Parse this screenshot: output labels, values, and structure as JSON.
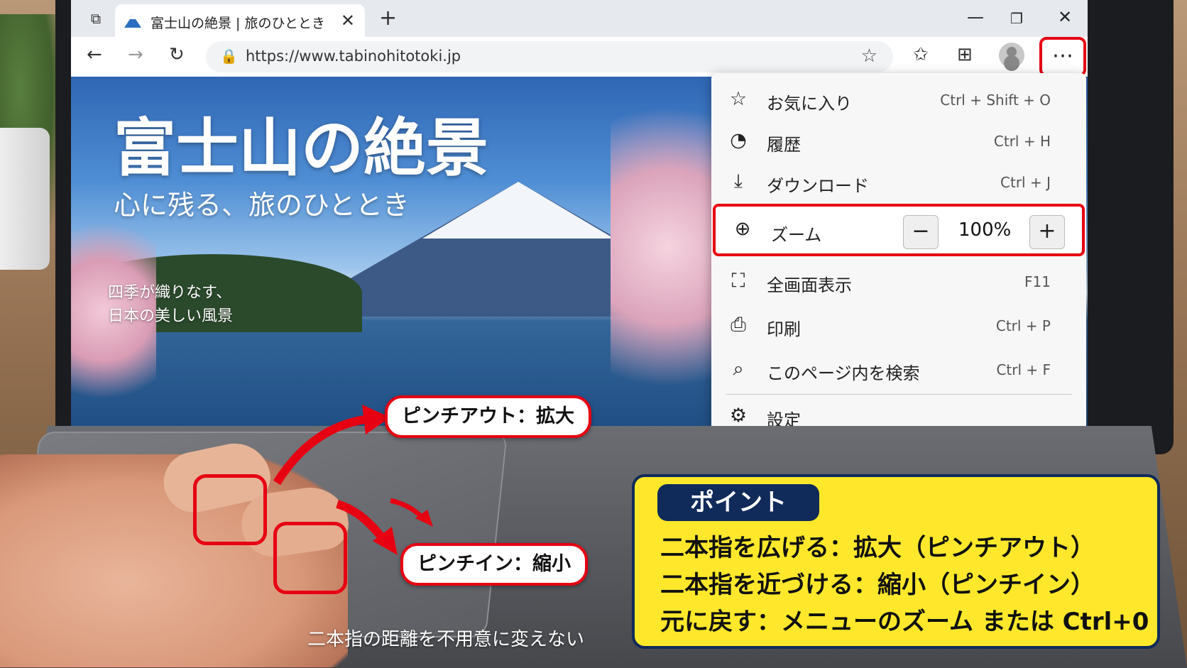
{
  "browser": {
    "tab_title": "富士山の絶景 | 旅のひととき",
    "url": "https://www.tabinohitotoki.jp"
  },
  "hero": {
    "title": "富士山の絶景",
    "subtitle": "心に残る、旅のひととき",
    "note_line1": "四季が織りなす、",
    "note_line2": "日本の美しい風景"
  },
  "menu": {
    "items": [
      {
        "label": "お気に入り",
        "shortcut": "Ctrl + Shift + O",
        "icon": "star-icon"
      },
      {
        "label": "履歴",
        "shortcut": "Ctrl + H",
        "icon": "history-icon"
      },
      {
        "label": "ダウンロード",
        "shortcut": "Ctrl + J",
        "icon": "download-icon"
      },
      {
        "label": "全画面表示",
        "shortcut": "F11",
        "icon": "fullscreen-icon"
      },
      {
        "label": "印刷",
        "shortcut": "Ctrl + P",
        "icon": "printer-icon"
      },
      {
        "label": "このページ内を検索",
        "shortcut": "Ctrl + F",
        "icon": "search-icon"
      },
      {
        "label": "設定",
        "shortcut": "",
        "icon": "gear-icon"
      }
    ],
    "zoom": {
      "label": "ズーム",
      "value": "100%",
      "icon": "zoom-icon"
    }
  },
  "callouts": {
    "pinch_out": "ピンチアウト：拡大",
    "pinch_in": "ピンチイン：縮小",
    "caption": "二本指の距離を不用意に変えない"
  },
  "point": {
    "title": "ポイント",
    "line1": "二本指を広げる：拡大（ピンチアウト）",
    "line2": "二本指を近づける：縮小（ピンチイン）",
    "line3": "元に戻す：メニューのズーム または Ctrl+0"
  },
  "colors": {
    "accent_red": "#e60012",
    "point_yellow": "#ffe82b",
    "point_navy": "#102a5a"
  }
}
